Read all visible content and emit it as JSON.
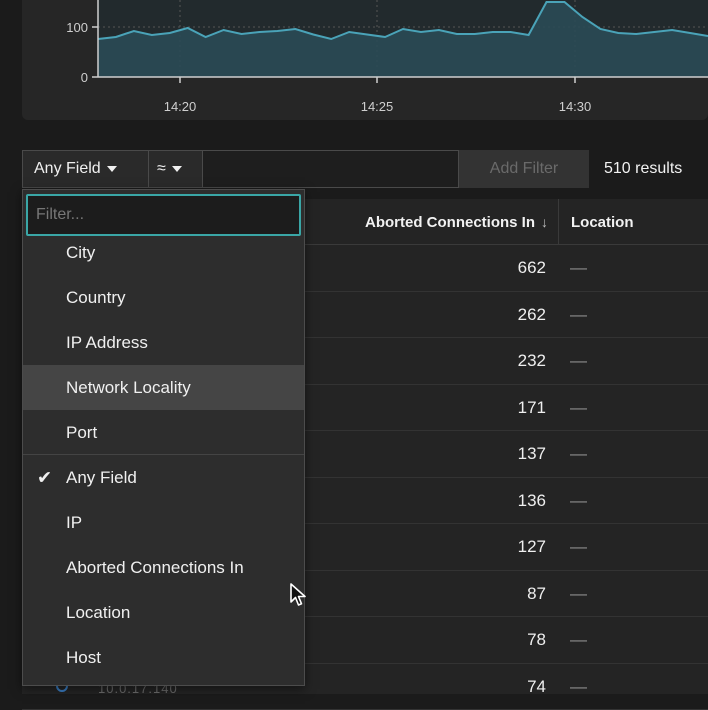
{
  "chart": {
    "y_ticks": [
      "100",
      "0"
    ],
    "x_ticks": [
      "14:20",
      "14:25",
      "14:30"
    ],
    "series": [
      76,
      80,
      92,
      84,
      88,
      98,
      80,
      94,
      86,
      90,
      92,
      96,
      85,
      76,
      90,
      85,
      80,
      96,
      90,
      94,
      86,
      86,
      90,
      90,
      84,
      150,
      150,
      120,
      96,
      88,
      86,
      90,
      94,
      88,
      82
    ]
  },
  "filter_bar": {
    "field_label": "Any Field",
    "operator_label": "≈",
    "value": "",
    "add_filter_label": "Add Filter",
    "results": "510 results"
  },
  "table": {
    "col_aborted": "Aborted Connections In",
    "sort_arrow": "↓",
    "col_location": "Location",
    "rows": [
      {
        "value": "662",
        "location": "—"
      },
      {
        "value": "262",
        "location": "—"
      },
      {
        "value": "232",
        "location": "—"
      },
      {
        "value": "171",
        "location": "—"
      },
      {
        "value": "137",
        "location": "—"
      },
      {
        "value": "136",
        "location": "—"
      },
      {
        "value": "127",
        "location": "—"
      },
      {
        "value": "87",
        "location": "—"
      },
      {
        "value": "78",
        "location": "—"
      },
      {
        "value": "74",
        "location": "—"
      }
    ],
    "partial_host": "10.0.17.140"
  },
  "dropdown": {
    "filter_placeholder": "Filter...",
    "items": [
      {
        "label": "City"
      },
      {
        "label": "Country"
      },
      {
        "label": "IP Address"
      },
      {
        "label": "Network Locality"
      },
      {
        "label": "Port"
      },
      {
        "label": "Any Field"
      },
      {
        "label": "IP"
      },
      {
        "label": "Aborted Connections In"
      },
      {
        "label": "Location"
      },
      {
        "label": "Host"
      }
    ],
    "selected": "Any Field",
    "hovered": "Network Locality",
    "check_glyph": "✔"
  },
  "colors": {
    "series_line": "#4aa3b8",
    "series_fill": "#2a4a55",
    "focus_border": "#3aa6a6"
  }
}
